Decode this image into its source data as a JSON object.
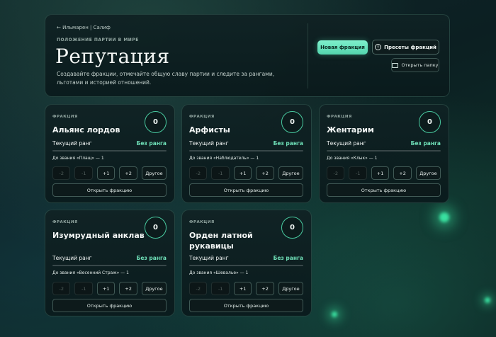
{
  "header": {
    "breadcrumb": "← Ильмарен | Салиф",
    "kicker": "ПОЛОЖЕНИЕ ПАРТИИ В МИРЕ",
    "title": "Репутация",
    "description": "Создавайте фракции, отмечайте общую славу партии и следите за рангами, льготами и историей отношений.",
    "new_faction_label": "Новая фракция",
    "presets_label": "Пресеты фракций",
    "open_folder_label": "Открыть папку"
  },
  "card_common": {
    "kicker": "ФРАКЦИЯ",
    "rank_label": "Текущий ранг",
    "rank_value": "Без ранга",
    "step_buttons": [
      "-2",
      "-1",
      "+1",
      "+2"
    ],
    "other_label": "Другое",
    "open_label": "Открыть фракцию"
  },
  "factions": [
    {
      "name": "Альянс лордов",
      "score": "0",
      "next_rank": "До звания «Плащ» — 1"
    },
    {
      "name": "Арфисты",
      "score": "0",
      "next_rank": "До звания «Наблюдатель» — 1"
    },
    {
      "name": "Жентарим",
      "score": "0",
      "next_rank": "До звания «Клык» — 1"
    },
    {
      "name": "Изумрудный анклав",
      "score": "0",
      "next_rank": "До звания «Весенний Страж» — 1"
    },
    {
      "name": "Орден латной рукавицы",
      "score": "0",
      "next_rank": "До звания «Шевалье» — 1"
    }
  ]
}
